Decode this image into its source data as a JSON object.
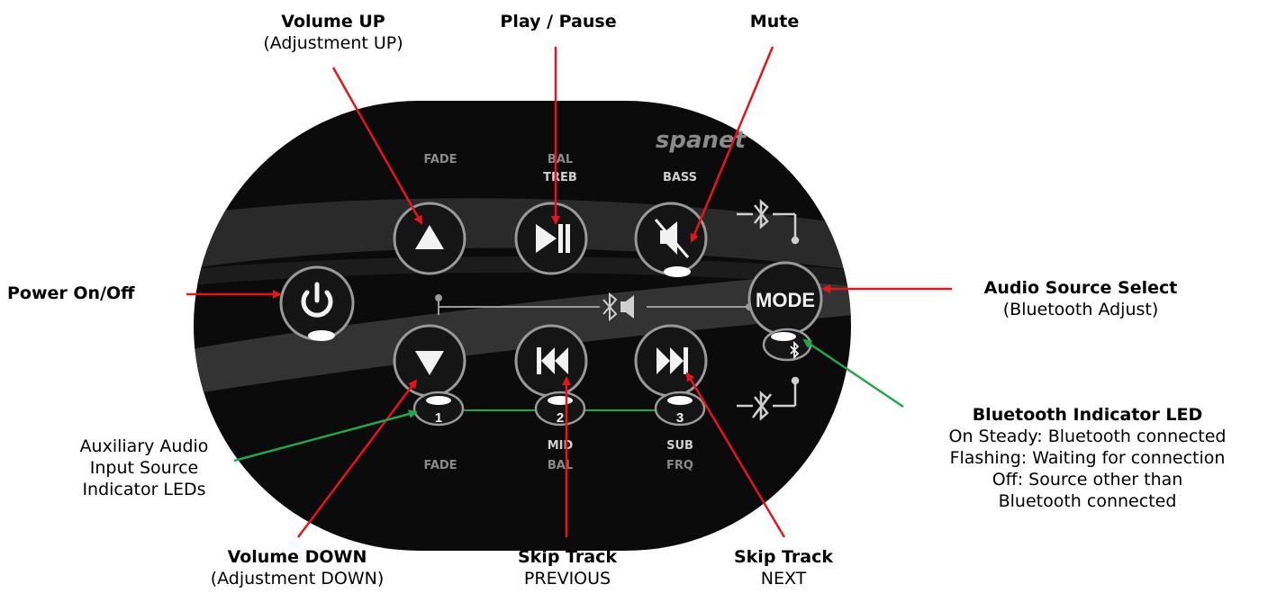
{
  "brand": "spanet",
  "panel_labels": {
    "fade_top": "FADE",
    "bal_top": "BAL",
    "treb": "TREB",
    "bass": "BASS",
    "mid": "MID",
    "bal_bottom": "BAL",
    "sub": "SUB",
    "frq": "FRQ",
    "fade_bottom": "FADE",
    "mode": "MODE",
    "led_1": "1",
    "led_2": "2",
    "led_3": "3"
  },
  "callouts": {
    "volume_up": {
      "title": "Volume UP",
      "sub": "(Adjustment UP)"
    },
    "play_pause": {
      "title": "Play / Pause"
    },
    "mute": {
      "title": "Mute"
    },
    "power": {
      "title": "Power On/Off"
    },
    "audio_source": {
      "title": "Audio Source Select",
      "sub": "(Bluetooth Adjust)"
    },
    "bt_led": {
      "title": "Bluetooth Indicator LED",
      "lines": [
        "On Steady: Bluetooth connected",
        "Flashing: Waiting for connection",
        "Off: Source other than",
        "Bluetooth connected"
      ]
    },
    "aux": {
      "lines": [
        "Auxiliary Audio",
        "Input Source",
        "Indicator LEDs"
      ]
    },
    "volume_down": {
      "title": "Volume DOWN",
      "sub": "(Adjustment DOWN)"
    },
    "skip_prev": {
      "title": "Skip Track",
      "sub": "PREVIOUS"
    },
    "skip_next": {
      "title": "Skip Track",
      "sub": "NEXT"
    }
  },
  "colors": {
    "panel": "#0b0b0b",
    "button": "#151515",
    "button_ring": "#9a9a9a",
    "swoosh": "#3a3a3a",
    "arrow_red": "#e8141c",
    "arrow_green": "#1fa84a"
  }
}
